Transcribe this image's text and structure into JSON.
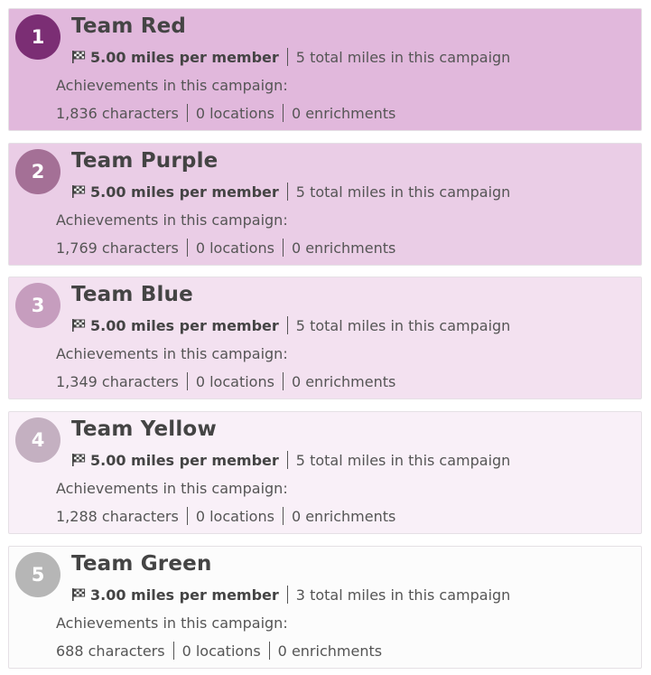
{
  "achievements_label": "Achievements in this campaign:",
  "icons": {
    "flag": "checkered-flag-icon"
  },
  "teams": [
    {
      "rank": "1",
      "name": "Team Red",
      "per_member": "5.00 miles per member",
      "total": "5 total miles in this campaign",
      "characters": "1,836 characters",
      "locations": "0 locations",
      "enrichments": "0 enrichments",
      "card_color": "#e1b8dc",
      "badge_color": "#7b2e74"
    },
    {
      "rank": "2",
      "name": "Team Purple",
      "per_member": "5.00 miles per member",
      "total": "5 total miles in this campaign",
      "characters": "1,769 characters",
      "locations": "0 locations",
      "enrichments": "0 enrichments",
      "card_color": "#eacde6",
      "badge_color": "#a47096"
    },
    {
      "rank": "3",
      "name": "Team Blue",
      "per_member": "5.00 miles per member",
      "total": "5 total miles in this campaign",
      "characters": "1,349 characters",
      "locations": "0 locations",
      "enrichments": "0 enrichments",
      "card_color": "#f3e1f0",
      "badge_color": "#c69dbe"
    },
    {
      "rank": "4",
      "name": "Team Yellow",
      "per_member": "5.00 miles per member",
      "total": "5 total miles in this campaign",
      "characters": "1,288 characters",
      "locations": "0 locations",
      "enrichments": "0 enrichments",
      "card_color": "#f9f0f8",
      "badge_color": "#c4b0c1"
    },
    {
      "rank": "5",
      "name": "Team Green",
      "per_member": "3.00 miles per member",
      "total": "3 total miles in this campaign",
      "characters": "688 characters",
      "locations": "0 locations",
      "enrichments": "0 enrichments",
      "card_color": "#fcfcfc",
      "badge_color": "#b6b6b6"
    }
  ]
}
